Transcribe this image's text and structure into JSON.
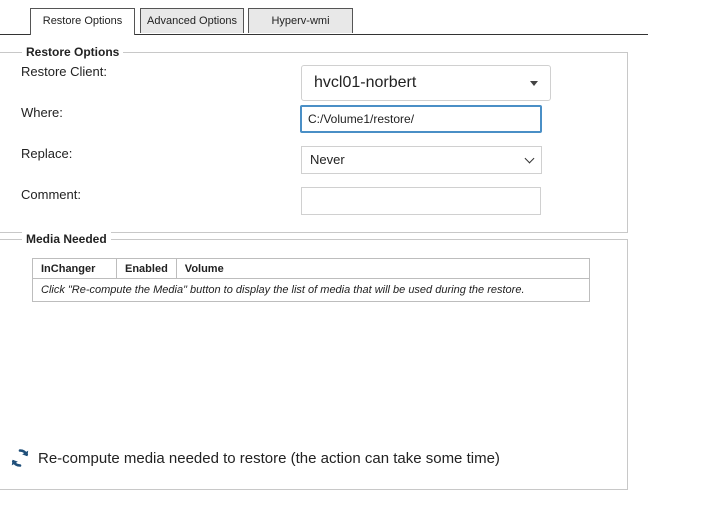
{
  "tabs": [
    {
      "label": "Restore Options"
    },
    {
      "label": "Advanced Options"
    },
    {
      "label": "Hyperv-wmi"
    }
  ],
  "restore_options": {
    "legend": "Restore Options",
    "client_label": "Restore Client:",
    "client_value": "hvcl01-norbert",
    "where_label": "Where:",
    "where_value": "C:/Volume1/restore/",
    "replace_label": "Replace:",
    "replace_value": "Never",
    "comment_label": "Comment:",
    "comment_value": ""
  },
  "media_needed": {
    "legend": "Media Needed",
    "columns": [
      "InChanger",
      "Enabled",
      "Volume"
    ],
    "empty_message": "Click \"Re-compute the Media\" button to display the list of media that will be used during the restore."
  },
  "recompute": {
    "label": "Re-compute media needed to restore (the action can take some time)",
    "icon": "refresh-icon"
  }
}
